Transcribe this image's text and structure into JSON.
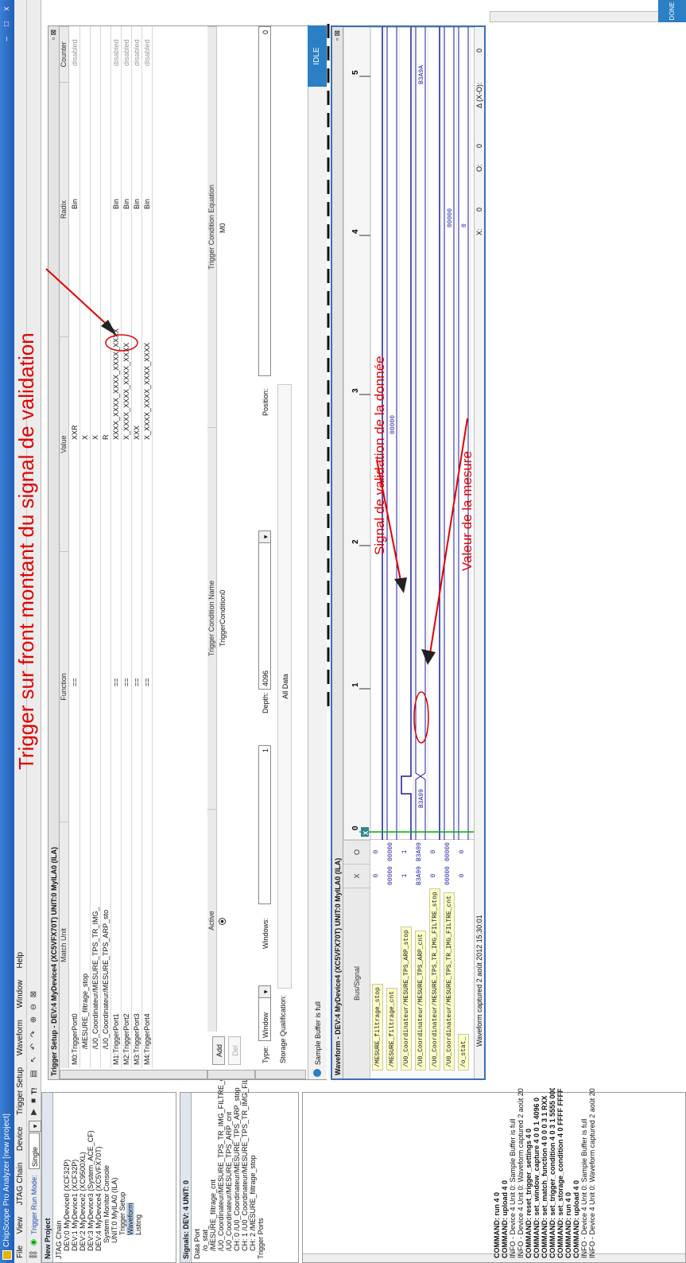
{
  "window": {
    "title": "ChipScope Pro Analyzer [new project]",
    "minimize": "–",
    "maximize": "□",
    "close": "x"
  },
  "menu": [
    "File",
    "View",
    "JTAG Chain",
    "Device",
    "Trigger Setup",
    "Waveform",
    "Window",
    "Help"
  ],
  "toolbar": {
    "run_mode_label": "Trigger Run Mode:",
    "run_mode_value": "Single",
    "t_label": "T!"
  },
  "project": {
    "title": "New Project",
    "tree": [
      "JTAG Chain",
      "DEV:0 MyDevice0 (XCF32P)",
      "DEV:1 MyDevice1 (XCF32P)",
      "DEV:2 MyDevice2 (XC9500XL)",
      "DEV:3 MyDevice3 (System_ACE_CF)",
      "DEV:4 MyDevice4 (XC5VFX70T)",
      "System Monitor Console",
      "UNIT:0 MyILA0 (ILA)",
      "Trigger Setup",
      "Waveform",
      "Listing"
    ]
  },
  "signals": {
    "title": "Signals: DEV: 4 UNIT: 0",
    "tree": [
      "Data Port",
      "/o_stat_",
      "/MESURE_filtrage_cnt",
      "/U0_Coordinateur/MESURE_TPS_TR_IMG_FILTRE_cn",
      "/U0_Coordinateur/MESURE_TPS_ARP_cnt",
      "CH: 0 /U0_Coordinateur/MESURE_TPS_ARP_stop",
      "CH: 1 /U0_Coordinateur/MESURE_TPS_TR_IMG_FILTR",
      "CH: 2 /MESURE_filtrage_stop",
      "Trigger Ports"
    ]
  },
  "trigger_setup": {
    "title": "Trigger Setup - DEV:4 MyDevice4 (XC5VFX70T) UNIT:0 MyILA0 (ILA)",
    "columns": [
      "Match Unit",
      "Function",
      "Value",
      "Radix",
      "Counter"
    ],
    "rows": [
      {
        "unit": "M0:TriggerPort0",
        "function": "==",
        "value": "XXR",
        "radix": "Bin",
        "counter": "disabled"
      },
      {
        "unit": "/MESURE_filtrage_stop",
        "function": "",
        "value": "X",
        "radix": "",
        "counter": ""
      },
      {
        "unit": "/U0_Coordinateur/MESURE_TPS_TR_IMG_",
        "function": "",
        "value": "X",
        "radix": "",
        "counter": ""
      },
      {
        "unit": "/U0_Coordinateur/MESURE_TPS_ARP_sto",
        "function": "",
        "value": "R",
        "radix": "",
        "counter": ""
      },
      {
        "unit": "M1:TriggerPort1",
        "function": "==",
        "value": "XXXX_XXXX_XXXX_XXXX_XXXX",
        "radix": "Bin",
        "counter": "disabled"
      },
      {
        "unit": "M2:TriggerPort2",
        "function": "==",
        "value": "X_XXXX_XXXX_XXXX_XXXX",
        "radix": "Bin",
        "counter": "disabled"
      },
      {
        "unit": "M3:TriggerPort3",
        "function": "==",
        "value": "XXX",
        "radix": "Bin",
        "counter": "disabled"
      },
      {
        "unit": "M4:TriggerPort4",
        "function": "==",
        "value": "X_XXXX_XXXX_XXXX_XXXX",
        "radix": "Bin",
        "counter": "disabled"
      }
    ],
    "match_tab": "Match",
    "trig_tab": "Trig",
    "capture_tab": "Capture",
    "trig_columns": [
      "Active",
      "Trigger Condition Name",
      "Trigger Condition Equation"
    ],
    "trig_row": {
      "name": "TriggerCondition0",
      "equation": "M0"
    },
    "add_label": "Add",
    "del_label": "Del",
    "type_label": "Type:",
    "type_value": "Window",
    "windows_label": "Windows:",
    "windows_value": "1",
    "depth_label": "Depth:",
    "depth_value": "4096",
    "position_label": "Position:",
    "position_value": "0",
    "storage_label": "Storage Qualification:",
    "storage_value": "All Data",
    "status": "Sample Buffer is full",
    "idle": "IDLE"
  },
  "waveform": {
    "title": "Waveform - DEV:4 MyDevice4 (XC5VFX70T) UNIT:0 MyILA0 (ILA)",
    "bus_signal_header": "Bus/Signal",
    "x_header": "X",
    "o_header": "O",
    "rows": [
      {
        "name": "/MESURE_filtrage_stop",
        "x": "0",
        "o": "0"
      },
      {
        "name": "/MESURE_filtrage_cnt",
        "x": "00000",
        "o": "00000"
      },
      {
        "name": "/U0_Coordinateur/MESURE_TPS_ARP_stop",
        "x": "1",
        "o": "1"
      },
      {
        "name": "/U0_Coordinateur/MESURE_TPS_ARP_cnt",
        "x": "B3A99",
        "o": "B3A99"
      },
      {
        "name": "/U0_Coordinateur/MESURE_TPS_TR_IMG_FILTRE_stop",
        "x": "0",
        "o": "0"
      },
      {
        "name": "/U0_Coordinateur/MESURE_TPS_TR_IMG_FILTRE_cnt",
        "x": "00000",
        "o": "00000"
      },
      {
        "name": "/o_stat_",
        "x": "0",
        "o": "0"
      }
    ],
    "time_ticks": [
      "0",
      "1",
      "2",
      "3",
      "4",
      "5"
    ],
    "trace_labels": {
      "cnt_a": "00000",
      "arp_cnt_a": "B3A99",
      "arp_cnt_b": "B3A9A",
      "filtre_cnt": "00000",
      "o_stat": "0"
    },
    "marker_x": "X",
    "marker_o": "O",
    "x_label": "X:",
    "x_value": "0",
    "o_label": "O:",
    "o_value": "0",
    "delta_label": "Δ (X-O):",
    "delta_value": "0",
    "status": "Waveform captured 2 août 2012 15:30:01"
  },
  "console": {
    "lines": [
      "COMMAND: run 4 0",
      "COMMAND: upload 4 0",
      "INFO - Device 4 Unit 0:  Sample Buffer is full",
      "INFO - Device 4 Unit 0: Waveform captured 2 août 2012 15:28:57",
      "COMMAND: reset_trigger_settings 4 0",
      "COMMAND: set_window_capture 4 0 0 1 4096 0",
      "COMMAND: set_match_function 4 0 0 0 3 1 RXX",
      "COMMAND: set_trigger_condition 4 0 3 1 5555 0000 5555",
      "COMMAND: set_storage_condition 4 0 FFFF FFFF",
      "COMMAND: run 4 0",
      "COMMAND: upload 4 0",
      "INFO - Device 4 Unit 0:  Sample Buffer is full",
      "INFO - Device 4 Unit 0: Waveform captured 2 août 2012 15:30:01"
    ]
  },
  "bottom_status": "DONE",
  "annotations": {
    "trigger": "Trigger sur front montant du signal de validation",
    "validation": "Signal de validation de la donnée",
    "mesure": "Valeur de la mesure"
  },
  "colors": {
    "annotation": "#e00000",
    "trace": "#1a1aa0",
    "cursor": "#00b000",
    "idle": "#2b7fc4"
  }
}
